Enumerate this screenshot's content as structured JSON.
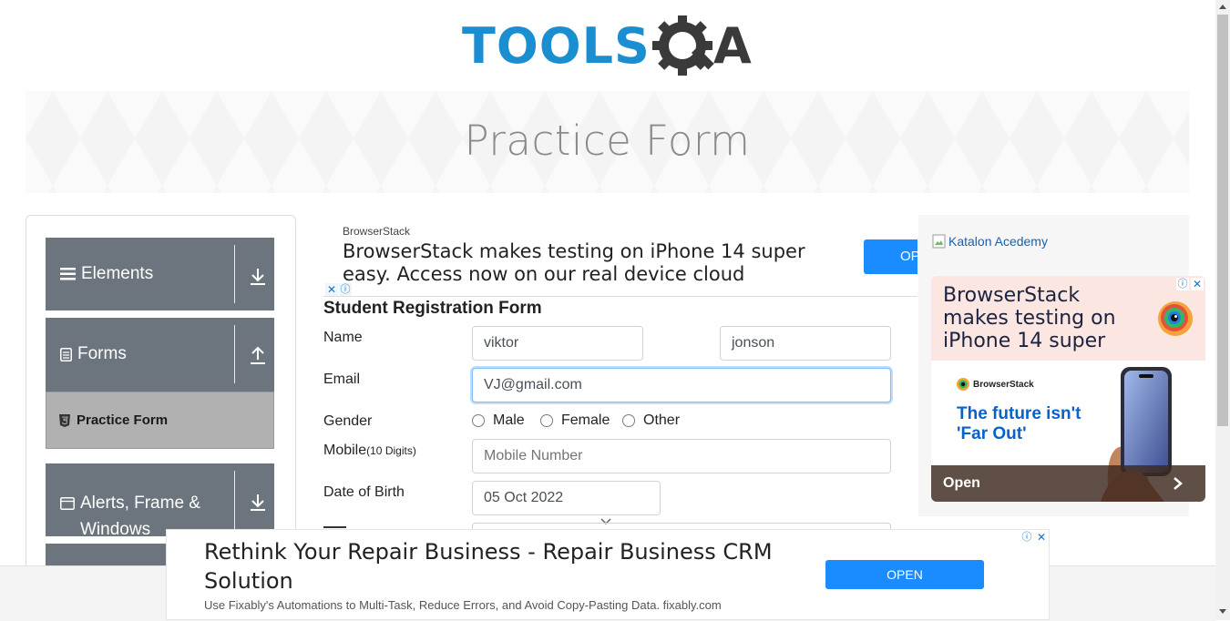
{
  "logo": {
    "text_left": "TOOLS",
    "text_right": "A",
    "colors": {
      "tools": "#1a8ed1",
      "qa": "#3a3a3a"
    }
  },
  "banner": {
    "title": "Practice Form"
  },
  "sidebar": {
    "groups": [
      {
        "label": "Elements",
        "icon": "hamburger-icon",
        "arrow": "download-arrow-icon"
      },
      {
        "label": "Forms",
        "icon": "document-icon",
        "arrow": "upload-arrow-icon"
      },
      {
        "label": "Alerts, Frame & Windows",
        "icon": "window-icon",
        "arrow": "download-arrow-icon"
      }
    ],
    "active_item": {
      "label": "Practice Form",
      "icon": "html5-icon"
    }
  },
  "ad_top": {
    "source": "BrowserStack",
    "headline": "BrowserStack makes testing on iPhone 14 super easy. Access now on our real device cloud",
    "open_label": "OPEN"
  },
  "form": {
    "title": "Student Registration Form",
    "name_label": "Name",
    "first_name": "viktor",
    "last_name": "jonson",
    "email_label": "Email",
    "email": "VJ@gmail.com",
    "gender_label": "Gender",
    "gender_options": [
      "Male",
      "Female",
      "Other"
    ],
    "mobile_label": "Mobile",
    "mobile_hint": "(10 Digits)",
    "mobile_placeholder": "Mobile Number",
    "dob_label": "Date of Birth",
    "dob_value": "05 Oct 2022"
  },
  "ad_right": {
    "alt_text": "Katalon Acedemy",
    "headline": "BrowserStack makes testing on iPhone 14 super",
    "brand": "BrowserStack",
    "tagline": "The future isn't 'Far Out'",
    "open_label": "Open"
  },
  "ad_bottom": {
    "headline": "Rethink Your Repair Business - Repair Business CRM Solution",
    "subtext": "Use Fixably's Automations to Multi-Task, Reduce Errors, and Avoid Copy-Pasting Data. fixably.com",
    "open_label": "OPEN"
  }
}
